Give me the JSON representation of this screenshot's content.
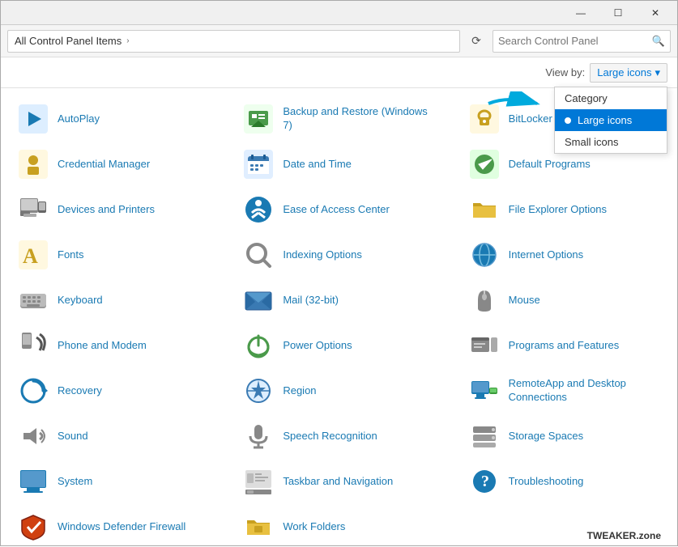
{
  "titlebar": {
    "minimize": "—",
    "maximize": "☐",
    "close": "✕"
  },
  "addressbar": {
    "path": "All Control Panel Items",
    "chevron": "›",
    "refresh": "⟳",
    "search_placeholder": "Search Control Panel",
    "search_icon": "🔍"
  },
  "viewby": {
    "label": "View by:",
    "current": "Large icons",
    "chevron": "▾",
    "options": [
      {
        "id": "category",
        "label": "Category",
        "selected": false
      },
      {
        "id": "large-icons",
        "label": "Large icons",
        "selected": true
      },
      {
        "id": "small-icons",
        "label": "Small icons",
        "selected": false
      }
    ]
  },
  "items": [
    {
      "id": "autoplay",
      "label": "AutoPlay",
      "icon": "▶",
      "col": 0
    },
    {
      "id": "backup",
      "label": "Backup and Restore (Windows 7)",
      "icon": "💾",
      "col": 1
    },
    {
      "id": "bitlocker",
      "label": "BitLocker Drive",
      "icon": "🔑",
      "col": 2
    },
    {
      "id": "credential",
      "label": "Credential Manager",
      "icon": "🔒",
      "col": 0
    },
    {
      "id": "datetime",
      "label": "Date and Time",
      "icon": "📅",
      "col": 1
    },
    {
      "id": "default",
      "label": "Default Programs",
      "icon": "✅",
      "col": 2
    },
    {
      "id": "devices",
      "label": "Devices and Printers",
      "icon": "🖨",
      "col": 0
    },
    {
      "id": "ease",
      "label": "Ease of Access Center",
      "icon": "⚙",
      "col": 1
    },
    {
      "id": "fileexplorer",
      "label": "File Explorer Options",
      "icon": "📁",
      "col": 2
    },
    {
      "id": "fonts",
      "label": "Fonts",
      "icon": "A",
      "col": 0
    },
    {
      "id": "indexing",
      "label": "Indexing Options",
      "icon": "🔍",
      "col": 1
    },
    {
      "id": "internet",
      "label": "Internet Options",
      "icon": "🌐",
      "col": 2
    },
    {
      "id": "keyboard",
      "label": "Keyboard",
      "icon": "⌨",
      "col": 0
    },
    {
      "id": "mail",
      "label": "Mail (32-bit)",
      "icon": "📧",
      "col": 1
    },
    {
      "id": "mouse",
      "label": "Mouse",
      "icon": "🖱",
      "col": 2
    },
    {
      "id": "phone",
      "label": "Phone and Modem",
      "icon": "📠",
      "col": 0
    },
    {
      "id": "power",
      "label": "Power Options",
      "icon": "⚡",
      "col": 1
    },
    {
      "id": "programs",
      "label": "Programs and Features",
      "icon": "💻",
      "col": 2
    },
    {
      "id": "recovery",
      "label": "Recovery",
      "icon": "🔄",
      "col": 0
    },
    {
      "id": "region",
      "label": "Region",
      "icon": "🕐",
      "col": 1
    },
    {
      "id": "remote",
      "label": "RemoteApp and Desktop Connections",
      "icon": "🖥",
      "col": 2
    },
    {
      "id": "sound",
      "label": "Sound",
      "icon": "🔊",
      "col": 0
    },
    {
      "id": "speech",
      "label": "Speech Recognition",
      "icon": "🎤",
      "col": 1
    },
    {
      "id": "storage",
      "label": "Storage Spaces",
      "icon": "🗄",
      "col": 2
    },
    {
      "id": "system",
      "label": "System",
      "icon": "🖥",
      "col": 0
    },
    {
      "id": "taskbar",
      "label": "Taskbar and Navigation",
      "icon": "📋",
      "col": 1
    },
    {
      "id": "troubleshoot",
      "label": "Troubleshooting",
      "icon": "🔧",
      "col": 2
    },
    {
      "id": "windows-defender",
      "label": "Windows Defender Firewall",
      "icon": "🛡",
      "col": 0
    },
    {
      "id": "work",
      "label": "Work Folders",
      "icon": "📁",
      "col": 1
    }
  ],
  "watermark": "TWEAKER.zone"
}
